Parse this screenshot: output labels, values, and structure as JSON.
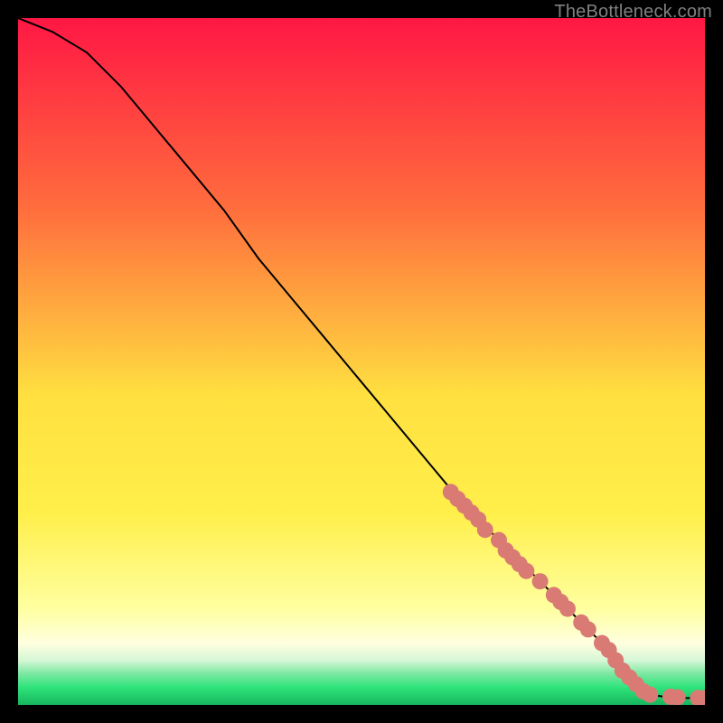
{
  "attribution": "TheBottleneck.com",
  "accent_colors": {
    "marker": "#d97b74",
    "line": "#000000",
    "gradient_top": "#ff1744",
    "gradient_mid_upper": "#ff8a3d",
    "gradient_mid": "#ffe040",
    "gradient_mid_lower": "#ffff8a",
    "gradient_low_pale": "#ffffc0",
    "gradient_green_pale": "#c8f7d0",
    "gradient_green": "#2ee37a",
    "gradient_green_deep": "#16b65d"
  },
  "chart_data": {
    "type": "line",
    "xlim": [
      0,
      100
    ],
    "ylim": [
      0,
      100
    ],
    "xlabel": "",
    "ylabel": "",
    "title": "",
    "grid": false,
    "legend": false,
    "series": [
      {
        "name": "bottleneck-curve",
        "x": [
          0,
          5,
          10,
          15,
          20,
          25,
          30,
          35,
          40,
          45,
          50,
          55,
          60,
          65,
          70,
          75,
          80,
          85,
          88,
          90,
          92,
          94,
          96,
          98,
          100
        ],
        "y": [
          100,
          98,
          95,
          90,
          84,
          78,
          72,
          65,
          59,
          53,
          47,
          41,
          35,
          29,
          24,
          19,
          14,
          9,
          5,
          3,
          1.5,
          1.2,
          1.0,
          1.0,
          1.0
        ]
      }
    ],
    "markers": [
      {
        "x": 63,
        "y": 31
      },
      {
        "x": 64,
        "y": 30
      },
      {
        "x": 65,
        "y": 29
      },
      {
        "x": 66,
        "y": 28
      },
      {
        "x": 67,
        "y": 27
      },
      {
        "x": 68,
        "y": 25.5
      },
      {
        "x": 70,
        "y": 24
      },
      {
        "x": 71,
        "y": 22.5
      },
      {
        "x": 72,
        "y": 21.5
      },
      {
        "x": 73,
        "y": 20.5
      },
      {
        "x": 74,
        "y": 19.5
      },
      {
        "x": 76,
        "y": 18
      },
      {
        "x": 78,
        "y": 16
      },
      {
        "x": 79,
        "y": 15
      },
      {
        "x": 80,
        "y": 14
      },
      {
        "x": 82,
        "y": 12
      },
      {
        "x": 83,
        "y": 11
      },
      {
        "x": 85,
        "y": 9
      },
      {
        "x": 86,
        "y": 8
      },
      {
        "x": 87,
        "y": 6.5
      },
      {
        "x": 88,
        "y": 5
      },
      {
        "x": 89,
        "y": 4
      },
      {
        "x": 90,
        "y": 3
      },
      {
        "x": 91,
        "y": 2
      },
      {
        "x": 92,
        "y": 1.5
      },
      {
        "x": 95,
        "y": 1.2
      },
      {
        "x": 96,
        "y": 1.1
      },
      {
        "x": 99,
        "y": 1.0
      },
      {
        "x": 100,
        "y": 1.0
      }
    ]
  }
}
